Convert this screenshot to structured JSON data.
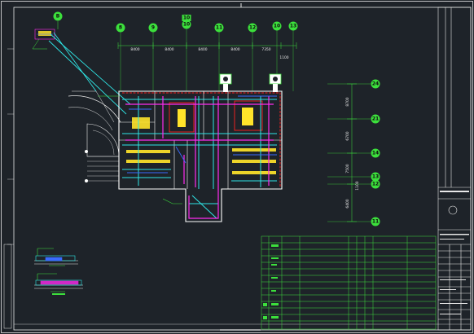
{
  "drawing": {
    "background_color": "#1e2329",
    "colors": {
      "frame": "#e8e8e8",
      "grid": "#3ce03c",
      "wall": "#ffffff",
      "cyan": "#2fe6e6",
      "magenta": "#ff2bf0",
      "red": "#ff2020",
      "yellow": "#ffe42a",
      "blue": "#3a6bff"
    },
    "top_axes": [
      {
        "label": "8"
      },
      {
        "label": "9"
      },
      {
        "label": "10"
      },
      {
        "label": "11"
      },
      {
        "label": "12"
      },
      {
        "label": "10"
      },
      {
        "label": "13"
      }
    ],
    "top_axis_10_sub": "10",
    "top_dimensions": [
      "8400",
      "8400",
      "8400",
      "8400",
      "7350"
    ],
    "top_dim_extra": "1100",
    "right_axes": [
      {
        "label": "24"
      },
      {
        "label": "21"
      },
      {
        "label": "14"
      },
      {
        "label": "13"
      },
      {
        "label": "12"
      },
      {
        "label": "11"
      }
    ],
    "right_dimensions": [
      "8700",
      "6700",
      "7500",
      "6400"
    ],
    "right_dim_extra": "1100",
    "left_axis": "B"
  }
}
